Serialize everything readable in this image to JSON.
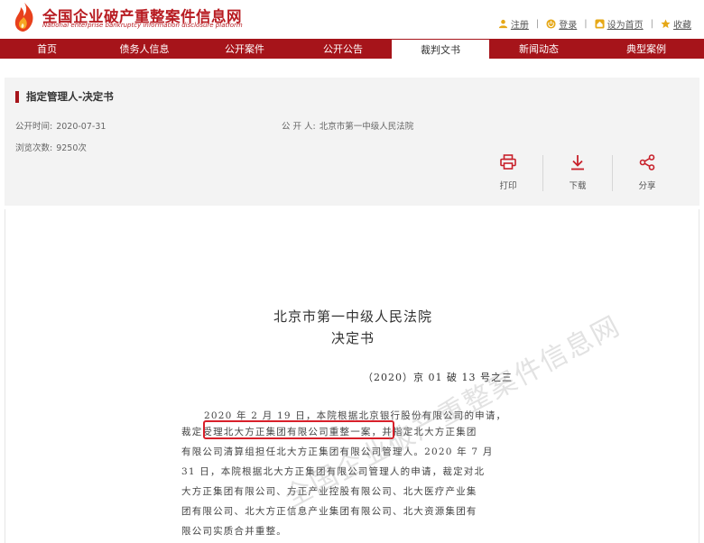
{
  "header": {
    "site_title": "全国企业破产重整案件信息网",
    "site_subtitle": "National enterprise bankruptcy information disclosure platform",
    "links": {
      "register": "注册",
      "login": "登录",
      "homepage": "设为首页",
      "favorite": "收藏"
    }
  },
  "nav": {
    "tabs": [
      {
        "label": "首页"
      },
      {
        "label": "债务人信息"
      },
      {
        "label": "公开案件"
      },
      {
        "label": "公开公告"
      },
      {
        "label": "裁判文书"
      },
      {
        "label": "新闻动态"
      },
      {
        "label": "典型案例"
      }
    ],
    "active": "裁判文书"
  },
  "document": {
    "heading": "指定管理人-决定书",
    "publish_time_label": "公开时间:",
    "publish_time": "2020-07-31",
    "publisher_label": "公 开 人:",
    "publisher": "北京市第一中级人民法院",
    "views_label": "浏览次数:",
    "views": "9250次"
  },
  "actions": {
    "print": "打印",
    "download": "下载",
    "share": "分享"
  },
  "content": {
    "court": "北京市第一中级人民法院",
    "doc_type": "决定书",
    "case_no": "（2020）京 01 破 13 号之三",
    "lines": [
      "2020 年 2 月 19 日，本院根据北京银行股份有限公司的申请，",
      "裁定受理北大方正集团有限公司重整一案，并指定北大方正集团",
      "有限公司清算组担任北大方正集团有限公司管理人。2020 年 7 月",
      "31 日，本院根据北大方正集团有限公司管理人的申请，裁定对北",
      "大方正集团有限公司、方正产业控股有限公司、北大医疗产业集",
      "团有限公司、北大方正信息产业集团有限公司、北大资源集团有",
      "限公司实质合并重整。"
    ],
    "watermark": "全国企业破产重整案件信息网"
  },
  "colors": {
    "brand": "#a6141a",
    "highlight": "#d8202a"
  }
}
